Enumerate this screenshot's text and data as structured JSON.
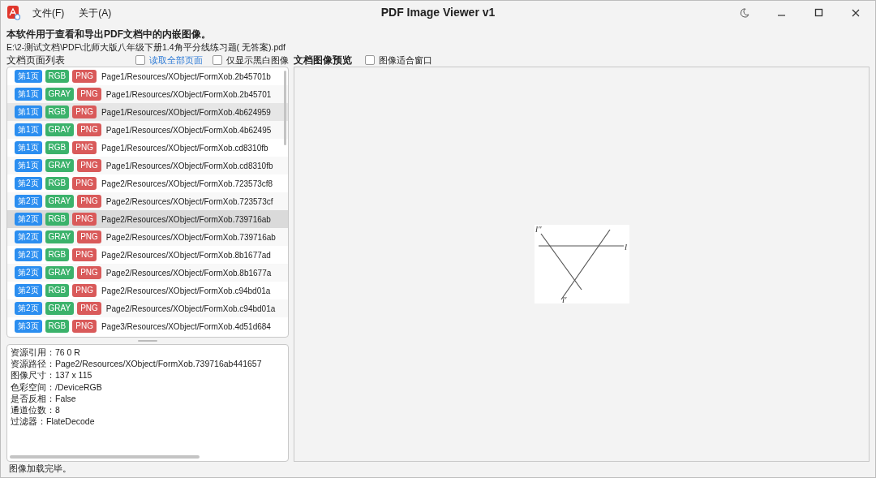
{
  "window": {
    "title": "PDF Image Viewer v1"
  },
  "menu": [
    "文件(F)",
    "关于(A)"
  ],
  "description": "本软件用于查看和导出PDF文档中的内嵌图像。",
  "file_path": "E:\\2-测试文档\\PDF\\北师大版八年级下册1.4角平分线练习题( 无答案).pdf",
  "page_list": {
    "title": "文档页面列表",
    "options": [
      {
        "label": "读取全部页面",
        "checked": false,
        "kind": "link"
      },
      {
        "label": "仅显示黑白图像",
        "checked": false,
        "kind": "plain"
      }
    ]
  },
  "preview": {
    "title": "文档图像预览",
    "options": [
      {
        "label": "图像适合窗口",
        "checked": false,
        "kind": "plain"
      }
    ],
    "figure_labels": [
      "l″",
      "l",
      "l′"
    ]
  },
  "images": [
    {
      "page": "第1页",
      "color_space": "RGB",
      "format": "PNG",
      "path": "Page1/Resources/XObject/FormXob.2b45701b",
      "selected": false,
      "hovered": false
    },
    {
      "page": "第1页",
      "color_space": "GRAY",
      "format": "PNG",
      "path": "Page1/Resources/XObject/FormXob.2b45701",
      "selected": false,
      "hovered": false
    },
    {
      "page": "第1页",
      "color_space": "RGB",
      "format": "PNG",
      "path": "Page1/Resources/XObject/FormXob.4b624959",
      "selected": false,
      "hovered": true
    },
    {
      "page": "第1页",
      "color_space": "GRAY",
      "format": "PNG",
      "path": "Page1/Resources/XObject/FormXob.4b62495",
      "selected": false,
      "hovered": false
    },
    {
      "page": "第1页",
      "color_space": "RGB",
      "format": "PNG",
      "path": "Page1/Resources/XObject/FormXob.cd8310fb",
      "selected": false,
      "hovered": false
    },
    {
      "page": "第1页",
      "color_space": "GRAY",
      "format": "PNG",
      "path": "Page1/Resources/XObject/FormXob.cd8310fb",
      "selected": false,
      "hovered": false
    },
    {
      "page": "第2页",
      "color_space": "RGB",
      "format": "PNG",
      "path": "Page2/Resources/XObject/FormXob.723573cf8",
      "selected": false,
      "hovered": false
    },
    {
      "page": "第2页",
      "color_space": "GRAY",
      "format": "PNG",
      "path": "Page2/Resources/XObject/FormXob.723573cf",
      "selected": false,
      "hovered": false
    },
    {
      "page": "第2页",
      "color_space": "RGB",
      "format": "PNG",
      "path": "Page2/Resources/XObject/FormXob.739716ab",
      "selected": true,
      "hovered": false
    },
    {
      "page": "第2页",
      "color_space": "GRAY",
      "format": "PNG",
      "path": "Page2/Resources/XObject/FormXob.739716ab",
      "selected": false,
      "hovered": false
    },
    {
      "page": "第2页",
      "color_space": "RGB",
      "format": "PNG",
      "path": "Page2/Resources/XObject/FormXob.8b1677ad",
      "selected": false,
      "hovered": false
    },
    {
      "page": "第2页",
      "color_space": "GRAY",
      "format": "PNG",
      "path": "Page2/Resources/XObject/FormXob.8b1677a",
      "selected": false,
      "hovered": false
    },
    {
      "page": "第2页",
      "color_space": "RGB",
      "format": "PNG",
      "path": "Page2/Resources/XObject/FormXob.c94bd01a",
      "selected": false,
      "hovered": false
    },
    {
      "page": "第2页",
      "color_space": "GRAY",
      "format": "PNG",
      "path": "Page2/Resources/XObject/FormXob.c94bd01a",
      "selected": false,
      "hovered": false
    },
    {
      "page": "第3页",
      "color_space": "RGB",
      "format": "PNG",
      "path": "Page3/Resources/XObject/FormXob.4d51d684",
      "selected": false,
      "hovered": false
    }
  ],
  "details": [
    {
      "label": "资源引用：",
      "value": "76 0 R"
    },
    {
      "label": "资源路径：",
      "value": "Page2/Resources/XObject/FormXob.739716ab441657"
    },
    {
      "label": "图像尺寸：",
      "value": "137 x 115"
    },
    {
      "label": "色彩空间：",
      "value": "/DeviceRGB"
    },
    {
      "label": "是否反相：",
      "value": "False"
    },
    {
      "label": "通道位数：",
      "value": "8"
    },
    {
      "label": "过滤器：",
      "value": "FlateDecode"
    }
  ],
  "status_bar": "图像加载完毕。"
}
